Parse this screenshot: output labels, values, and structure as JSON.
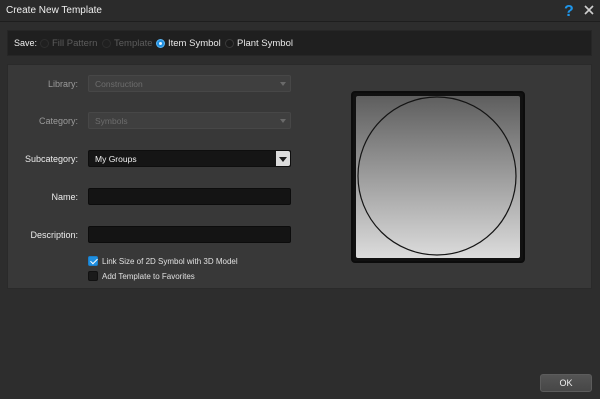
{
  "window": {
    "title": "Create New Template",
    "help_icon": "question-mark-icon",
    "close_icon": "close-x-icon",
    "accent_color": "#1f8fe0"
  },
  "save": {
    "label": "Save:",
    "options": [
      {
        "label": "Fill Pattern",
        "state": "disabled"
      },
      {
        "label": "Template",
        "state": "disabled"
      },
      {
        "label": "Item Symbol",
        "state": "selected"
      },
      {
        "label": "Plant Symbol",
        "state": "enabled"
      }
    ]
  },
  "form": {
    "library": {
      "label": "Library:",
      "value": "Construction",
      "enabled": false
    },
    "category": {
      "label": "Category:",
      "placeholder": "Symbols",
      "enabled": false
    },
    "subcategory": {
      "label": "Subcategory:",
      "value": "My Groups",
      "enabled": true
    },
    "name": {
      "label": "Name:",
      "value": ""
    },
    "description": {
      "label": "Description:",
      "value": ""
    },
    "link_size": {
      "label": "Link Size of 2D Symbol with 3D Model",
      "checked": true
    },
    "add_favorites": {
      "label": "Add Template to Favorites",
      "checked": false
    }
  },
  "footer": {
    "ok_label": "OK"
  }
}
